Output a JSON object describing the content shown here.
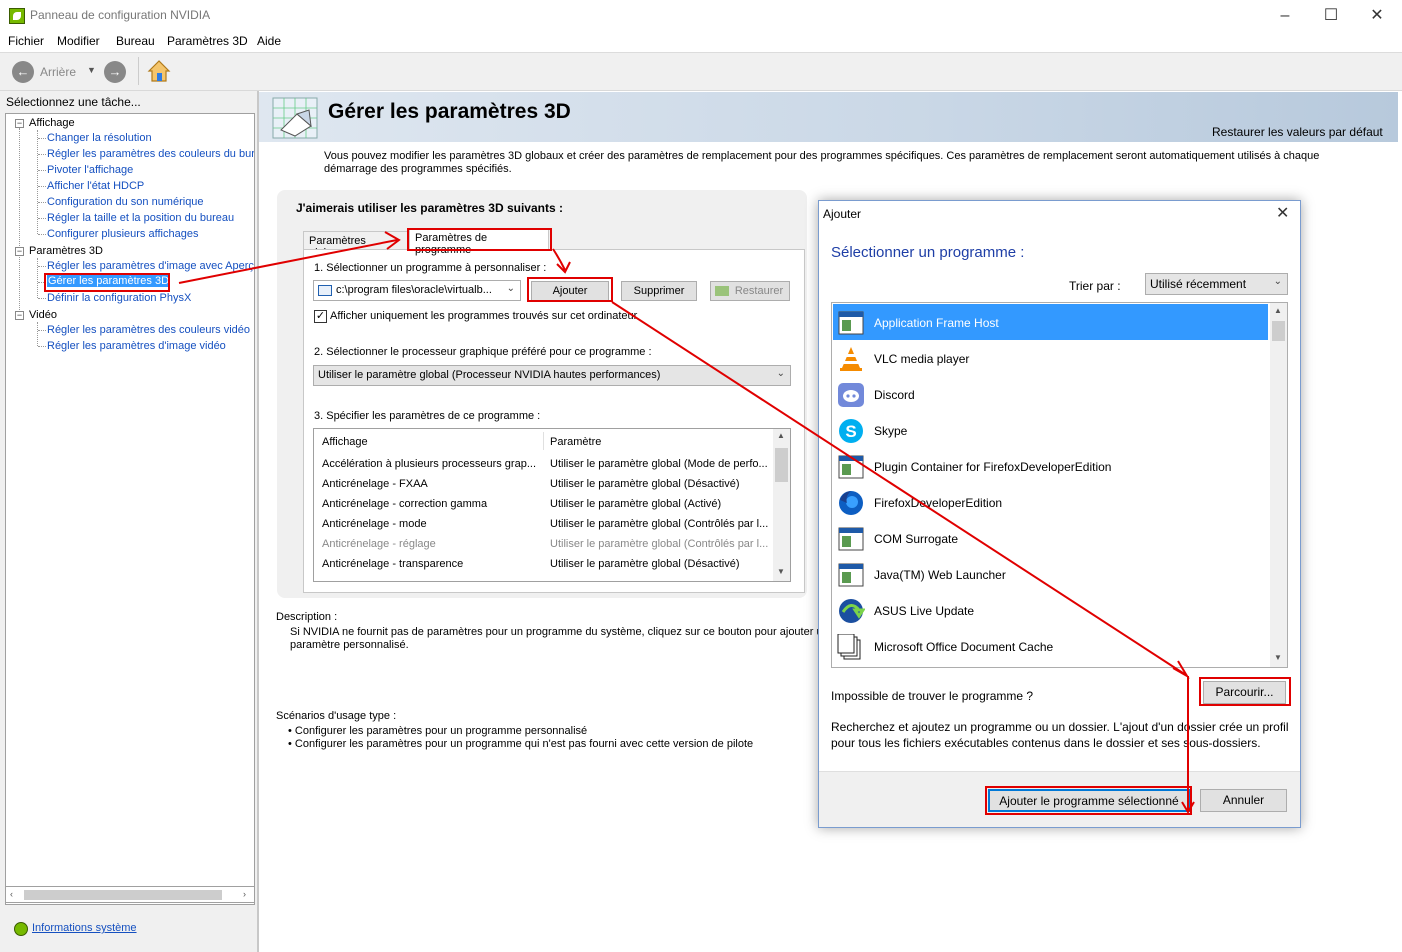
{
  "window": {
    "title": "Panneau de configuration NVIDIA",
    "minimize": "–",
    "maximize": "☐",
    "close": "✕"
  },
  "menu": [
    "Fichier",
    "Modifier",
    "Bureau",
    "Paramètres 3D",
    "Aide"
  ],
  "toolbar": {
    "back_label": "Arrière"
  },
  "left": {
    "header": "Sélectionnez une tâche...",
    "categories": [
      {
        "label": "Affichage",
        "items": [
          "Changer la résolution",
          "Régler les paramètres des couleurs du bureau",
          "Pivoter l'affichage",
          "Afficher l'état HDCP",
          "Configuration du son numérique",
          "Régler la taille et la position du bureau",
          "Configurer plusieurs affichages"
        ]
      },
      {
        "label": "Paramètres 3D",
        "items": [
          "Régler les paramètres d'image avec Aperçu",
          "Gérer les paramètres 3D",
          "Définir la configuration PhysX"
        ]
      },
      {
        "label": "Vidéo",
        "items": [
          "Régler les paramètres des couleurs vidéo",
          "Régler les paramètres d'image vidéo"
        ]
      }
    ],
    "system_info": "Informations système"
  },
  "main": {
    "title": "Gérer les paramètres 3D",
    "restore_defaults": "Restaurer les valeurs par défaut",
    "intro": "Vous pouvez modifier les paramètres 3D globaux et créer des paramètres de remplacement pour des programmes spécifiques. Ces paramètres de remplacement seront automatiquement utilisés à chaque démarrage des programmes spécifiés.",
    "panel_heading": "J'aimerais utiliser les paramètres 3D suivants :",
    "tabs": [
      "Paramètres globaux",
      "Paramètres de programme"
    ],
    "step1": "1. Sélectionner un programme à personnaliser :",
    "program_value": "c:\\program files\\oracle\\virtualb...",
    "add_button": "Ajouter",
    "remove_button": "Supprimer",
    "restore_button": "Restaurer",
    "show_only_label": "Afficher uniquement les programmes trouvés sur cet ordinateur",
    "step2": "2. Sélectionner le processeur graphique préféré pour ce programme :",
    "gpu_value": "Utiliser le paramètre global (Processeur NVIDIA hautes performances)",
    "step3": "3. Spécifier les paramètres de ce programme :",
    "list_headers": [
      "Affichage",
      "Paramètre"
    ],
    "list_rows": [
      {
        "feature": "Accélération à plusieurs processeurs grap...",
        "value": "Utiliser le paramètre global (Mode de perfo..."
      },
      {
        "feature": "Anticrénelage - FXAA",
        "value": "Utiliser le paramètre global (Désactivé)"
      },
      {
        "feature": "Anticrénelage - correction gamma",
        "value": "Utiliser le paramètre global (Activé)"
      },
      {
        "feature": "Anticrénelage - mode",
        "value": "Utiliser le paramètre global (Contrôlés par l..."
      },
      {
        "feature": "Anticrénelage - réglage",
        "value": "Utiliser le paramètre global (Contrôlés par l..."
      },
      {
        "feature": "Anticrénelage - transparence",
        "value": "Utiliser le paramètre global (Désactivé)"
      }
    ],
    "description_label": "Description :",
    "description_text_1": "Si NVIDIA ne fournit pas de paramètres pour un programme du système, cliquez sur ce bouton pour ajouter un",
    "description_text_2": "paramètre personnalisé.",
    "usage_label": "Scénarios d'usage type :",
    "usage_items": [
      "• Configurer les paramètres pour un programme personnalisé",
      "• Configurer les paramètres pour un programme qui n'est pas fourni avec cette version de pilote"
    ]
  },
  "dialog": {
    "title": "Ajouter",
    "close": "✕",
    "heading": "Sélectionner un programme :",
    "sort_label": "Trier par :",
    "sort_value": "Utilisé récemment",
    "programs": [
      "Application Frame Host",
      "VLC media player",
      "Discord",
      "Skype",
      "Plugin Container for FirefoxDeveloperEdition",
      "FirefoxDeveloperEdition",
      "COM Surrogate",
      "Java(TM) Web Launcher",
      "ASUS Live Update",
      "Microsoft Office Document Cache"
    ],
    "not_found": "Impossible de trouver le programme ?",
    "browse_button": "Parcourir...",
    "hint": "Recherchez et ajoutez un programme ou un dossier. L'ajout d'un dossier crée un profil pour tous les fichiers exécutables contenus dans le dossier et ses sous-dossiers.",
    "add_selected_button": "Ajouter le programme sélectionné",
    "cancel_button": "Annuler"
  },
  "colors": {
    "accent_red": "#e00000",
    "selection_blue": "#3399ff",
    "link_blue": "#1550c0",
    "nvidia_green": "#76b900"
  }
}
